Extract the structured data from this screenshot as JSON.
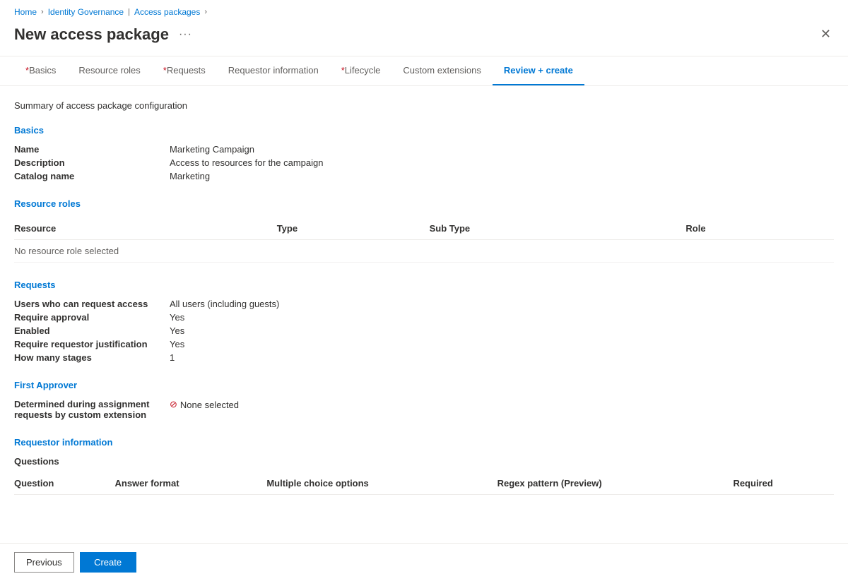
{
  "breadcrumb": {
    "home": "Home",
    "identity_governance": "Identity Governance",
    "access_packages": "Access packages"
  },
  "page": {
    "title": "New access package",
    "summary_text": "Summary of access package configuration"
  },
  "tabs": [
    {
      "id": "basics",
      "label": "Basics",
      "required": true,
      "active": false
    },
    {
      "id": "resource-roles",
      "label": "Resource roles",
      "required": false,
      "active": false
    },
    {
      "id": "requests",
      "label": "Requests",
      "required": true,
      "active": false
    },
    {
      "id": "requestor-information",
      "label": "Requestor information",
      "required": false,
      "active": false
    },
    {
      "id": "lifecycle",
      "label": "Lifecycle",
      "required": true,
      "active": false
    },
    {
      "id": "custom-extensions",
      "label": "Custom extensions",
      "required": false,
      "active": false
    },
    {
      "id": "review-create",
      "label": "Review + create",
      "required": false,
      "active": true
    }
  ],
  "basics": {
    "section_title": "Basics",
    "fields": [
      {
        "label": "Name",
        "value": "Marketing Campaign"
      },
      {
        "label": "Description",
        "value": "Access to resources for the campaign"
      },
      {
        "label": "Catalog name",
        "value": "Marketing"
      }
    ]
  },
  "resource_roles": {
    "section_title": "Resource roles",
    "table_headers": [
      "Resource",
      "Type",
      "Sub Type",
      "Role"
    ],
    "no_data_message": "No resource role selected"
  },
  "requests": {
    "section_title": "Requests",
    "fields": [
      {
        "label": "Users who can request access",
        "value": "All users (including guests)"
      },
      {
        "label": "Require approval",
        "value": "Yes"
      },
      {
        "label": "Enabled",
        "value": "Yes"
      },
      {
        "label": "Require requestor justification",
        "value": "Yes"
      },
      {
        "label": "How many stages",
        "value": "1"
      }
    ]
  },
  "first_approver": {
    "section_title": "First Approver",
    "label": "Determined during assignment requests by custom extension",
    "value": "None selected",
    "error": true
  },
  "requestor_information": {
    "section_title": "Requestor information",
    "questions_label": "Questions",
    "table_headers": [
      "Question",
      "Answer format",
      "Multiple choice options",
      "Regex pattern (Preview)",
      "Required"
    ]
  },
  "footer": {
    "previous_label": "Previous",
    "create_label": "Create"
  }
}
